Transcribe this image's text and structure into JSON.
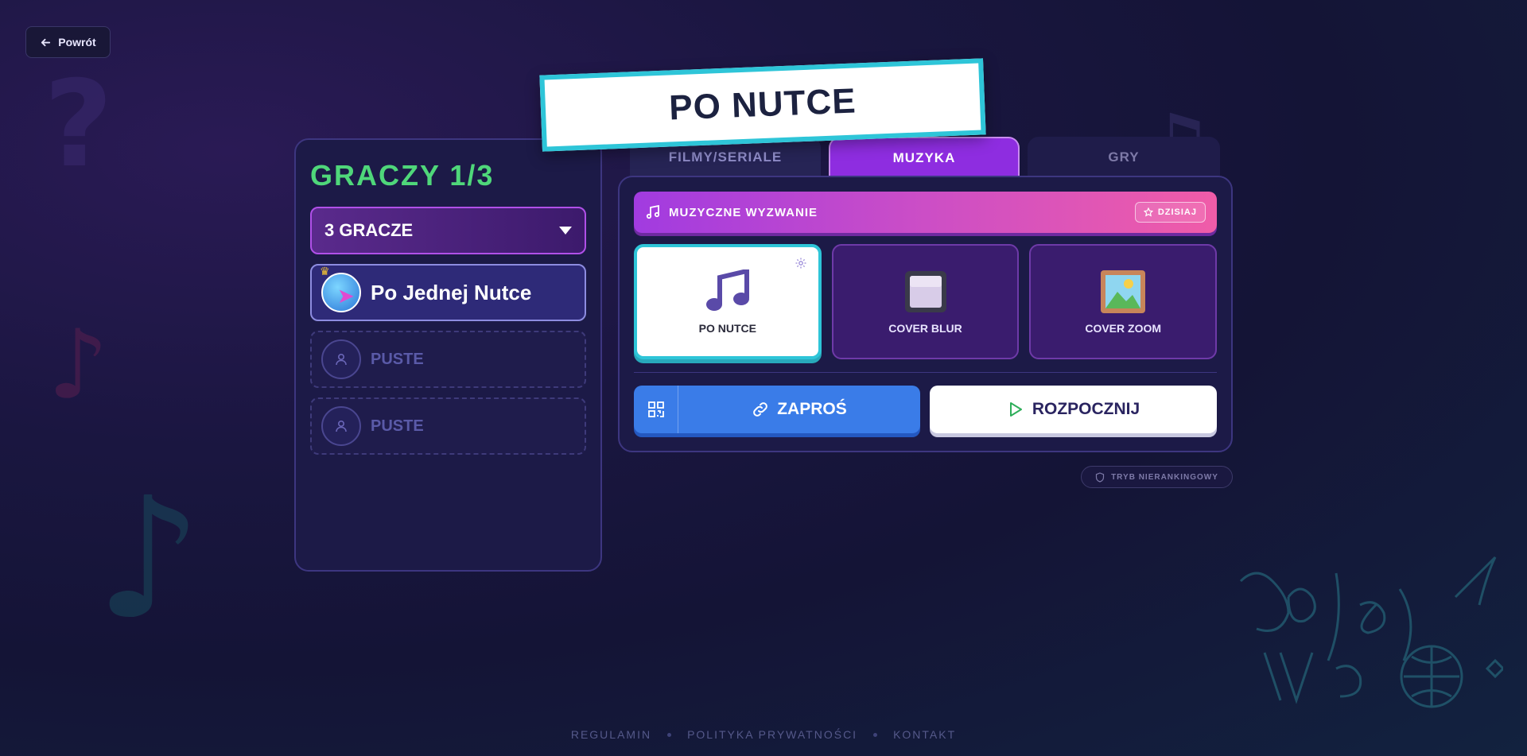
{
  "nav": {
    "back_label": "Powrót"
  },
  "title": "PO NUTCE",
  "players": {
    "heading": "GRACZY 1/3",
    "count_select": "3 GRACZE",
    "slots": [
      {
        "name": "Po Jednej Nutce",
        "filled": true
      },
      {
        "name": "PUSTE",
        "filled": false
      },
      {
        "name": "PUSTE",
        "filled": false
      }
    ]
  },
  "tabs": [
    {
      "label": "FILMY/SERIALE",
      "active": false
    },
    {
      "label": "MUZYKA",
      "active": true
    },
    {
      "label": "GRY",
      "active": false
    }
  ],
  "challenge": {
    "label": "MUZYCZNE WYZWANIE",
    "badge": "DZISIAJ"
  },
  "modes": [
    {
      "label": "PO NUTCE",
      "icon": "music-notes-icon",
      "active": true
    },
    {
      "label": "COVER BLUR",
      "icon": "blur-square-icon",
      "active": false
    },
    {
      "label": "COVER ZOOM",
      "icon": "framed-picture-icon",
      "active": false
    }
  ],
  "actions": {
    "invite": "ZAPROŚ",
    "start": "ROZPOCZNIJ"
  },
  "unranked": "TRYB NIERANKINGOWY",
  "footer": {
    "terms": "REGULAMIN",
    "privacy": "POLITYKA PRYWATNOŚCI",
    "contact": "KONTAKT"
  },
  "colors": {
    "accent_green": "#4fd77a",
    "accent_cyan": "#2ec5d8",
    "accent_purple": "#8e2de0",
    "invite_blue": "#3a7ce8",
    "background": "#141436"
  }
}
